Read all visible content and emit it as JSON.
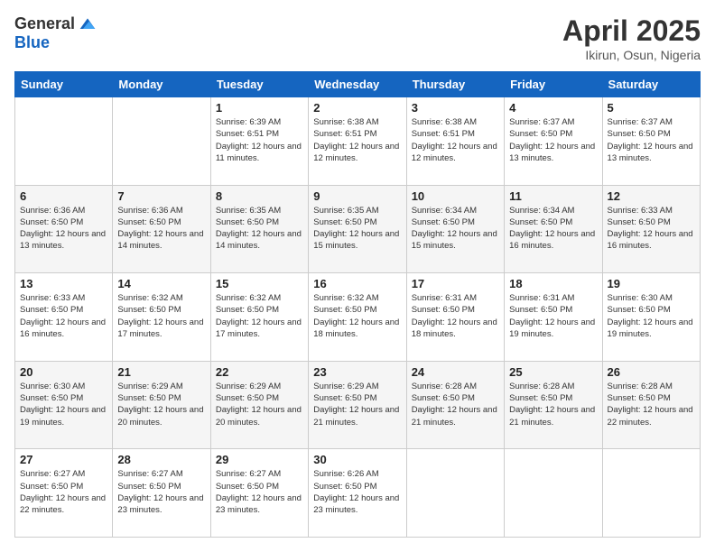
{
  "logo": {
    "general": "General",
    "blue": "Blue"
  },
  "title": "April 2025",
  "location": "Ikirun, Osun, Nigeria",
  "days_header": [
    "Sunday",
    "Monday",
    "Tuesday",
    "Wednesday",
    "Thursday",
    "Friday",
    "Saturday"
  ],
  "weeks": [
    [
      {
        "day": "",
        "info": ""
      },
      {
        "day": "",
        "info": ""
      },
      {
        "day": "1",
        "info": "Sunrise: 6:39 AM\nSunset: 6:51 PM\nDaylight: 12 hours and 11 minutes."
      },
      {
        "day": "2",
        "info": "Sunrise: 6:38 AM\nSunset: 6:51 PM\nDaylight: 12 hours and 12 minutes."
      },
      {
        "day": "3",
        "info": "Sunrise: 6:38 AM\nSunset: 6:51 PM\nDaylight: 12 hours and 12 minutes."
      },
      {
        "day": "4",
        "info": "Sunrise: 6:37 AM\nSunset: 6:50 PM\nDaylight: 12 hours and 13 minutes."
      },
      {
        "day": "5",
        "info": "Sunrise: 6:37 AM\nSunset: 6:50 PM\nDaylight: 12 hours and 13 minutes."
      }
    ],
    [
      {
        "day": "6",
        "info": "Sunrise: 6:36 AM\nSunset: 6:50 PM\nDaylight: 12 hours and 13 minutes."
      },
      {
        "day": "7",
        "info": "Sunrise: 6:36 AM\nSunset: 6:50 PM\nDaylight: 12 hours and 14 minutes."
      },
      {
        "day": "8",
        "info": "Sunrise: 6:35 AM\nSunset: 6:50 PM\nDaylight: 12 hours and 14 minutes."
      },
      {
        "day": "9",
        "info": "Sunrise: 6:35 AM\nSunset: 6:50 PM\nDaylight: 12 hours and 15 minutes."
      },
      {
        "day": "10",
        "info": "Sunrise: 6:34 AM\nSunset: 6:50 PM\nDaylight: 12 hours and 15 minutes."
      },
      {
        "day": "11",
        "info": "Sunrise: 6:34 AM\nSunset: 6:50 PM\nDaylight: 12 hours and 16 minutes."
      },
      {
        "day": "12",
        "info": "Sunrise: 6:33 AM\nSunset: 6:50 PM\nDaylight: 12 hours and 16 minutes."
      }
    ],
    [
      {
        "day": "13",
        "info": "Sunrise: 6:33 AM\nSunset: 6:50 PM\nDaylight: 12 hours and 16 minutes."
      },
      {
        "day": "14",
        "info": "Sunrise: 6:32 AM\nSunset: 6:50 PM\nDaylight: 12 hours and 17 minutes."
      },
      {
        "day": "15",
        "info": "Sunrise: 6:32 AM\nSunset: 6:50 PM\nDaylight: 12 hours and 17 minutes."
      },
      {
        "day": "16",
        "info": "Sunrise: 6:32 AM\nSunset: 6:50 PM\nDaylight: 12 hours and 18 minutes."
      },
      {
        "day": "17",
        "info": "Sunrise: 6:31 AM\nSunset: 6:50 PM\nDaylight: 12 hours and 18 minutes."
      },
      {
        "day": "18",
        "info": "Sunrise: 6:31 AM\nSunset: 6:50 PM\nDaylight: 12 hours and 19 minutes."
      },
      {
        "day": "19",
        "info": "Sunrise: 6:30 AM\nSunset: 6:50 PM\nDaylight: 12 hours and 19 minutes."
      }
    ],
    [
      {
        "day": "20",
        "info": "Sunrise: 6:30 AM\nSunset: 6:50 PM\nDaylight: 12 hours and 19 minutes."
      },
      {
        "day": "21",
        "info": "Sunrise: 6:29 AM\nSunset: 6:50 PM\nDaylight: 12 hours and 20 minutes."
      },
      {
        "day": "22",
        "info": "Sunrise: 6:29 AM\nSunset: 6:50 PM\nDaylight: 12 hours and 20 minutes."
      },
      {
        "day": "23",
        "info": "Sunrise: 6:29 AM\nSunset: 6:50 PM\nDaylight: 12 hours and 21 minutes."
      },
      {
        "day": "24",
        "info": "Sunrise: 6:28 AM\nSunset: 6:50 PM\nDaylight: 12 hours and 21 minutes."
      },
      {
        "day": "25",
        "info": "Sunrise: 6:28 AM\nSunset: 6:50 PM\nDaylight: 12 hours and 21 minutes."
      },
      {
        "day": "26",
        "info": "Sunrise: 6:28 AM\nSunset: 6:50 PM\nDaylight: 12 hours and 22 minutes."
      }
    ],
    [
      {
        "day": "27",
        "info": "Sunrise: 6:27 AM\nSunset: 6:50 PM\nDaylight: 12 hours and 22 minutes."
      },
      {
        "day": "28",
        "info": "Sunrise: 6:27 AM\nSunset: 6:50 PM\nDaylight: 12 hours and 23 minutes."
      },
      {
        "day": "29",
        "info": "Sunrise: 6:27 AM\nSunset: 6:50 PM\nDaylight: 12 hours and 23 minutes."
      },
      {
        "day": "30",
        "info": "Sunrise: 6:26 AM\nSunset: 6:50 PM\nDaylight: 12 hours and 23 minutes."
      },
      {
        "day": "",
        "info": ""
      },
      {
        "day": "",
        "info": ""
      },
      {
        "day": "",
        "info": ""
      }
    ]
  ]
}
